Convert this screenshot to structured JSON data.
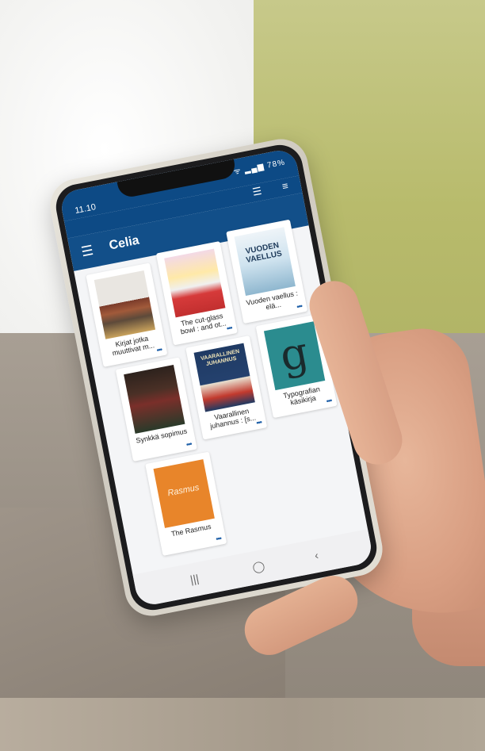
{
  "status_bar": {
    "time": "11.10",
    "icons": "⚙ ⌁ ᯤ ▂▄▆ 78%"
  },
  "toolbar": {
    "sort_icon": "sort-icon",
    "list_icon": "list-view-icon"
  },
  "app_bar": {
    "title": "Celia"
  },
  "books": [
    {
      "title": "Kirjat jotka muuttivat m...",
      "cover_color": "#d9d6cf"
    },
    {
      "title": "The cut-glass bowl : and ot...",
      "cover_color": "#d63a3a"
    },
    {
      "title": "Vuoden vaellus : elä...",
      "cover_color": "#cfe3ef",
      "cover_text": "VUODEN VAELLUS"
    },
    {
      "title": "Synkkä sopimus",
      "cover_color": "#3f2a22"
    },
    {
      "title": "Vaarallinen juhannus : [s...",
      "cover_color": "#1f3a63",
      "cover_text": "VAARALLINEN JUHANNUS"
    },
    {
      "title": "Typografian käsikirja",
      "cover_color": "#2b8c8f",
      "cover_text": "g"
    },
    {
      "title": "The Rasmus",
      "cover_color": "#e8852a",
      "cover_text": "Rasmus"
    }
  ],
  "nav": {
    "recent": "|||",
    "home": "◯",
    "back": "‹"
  }
}
